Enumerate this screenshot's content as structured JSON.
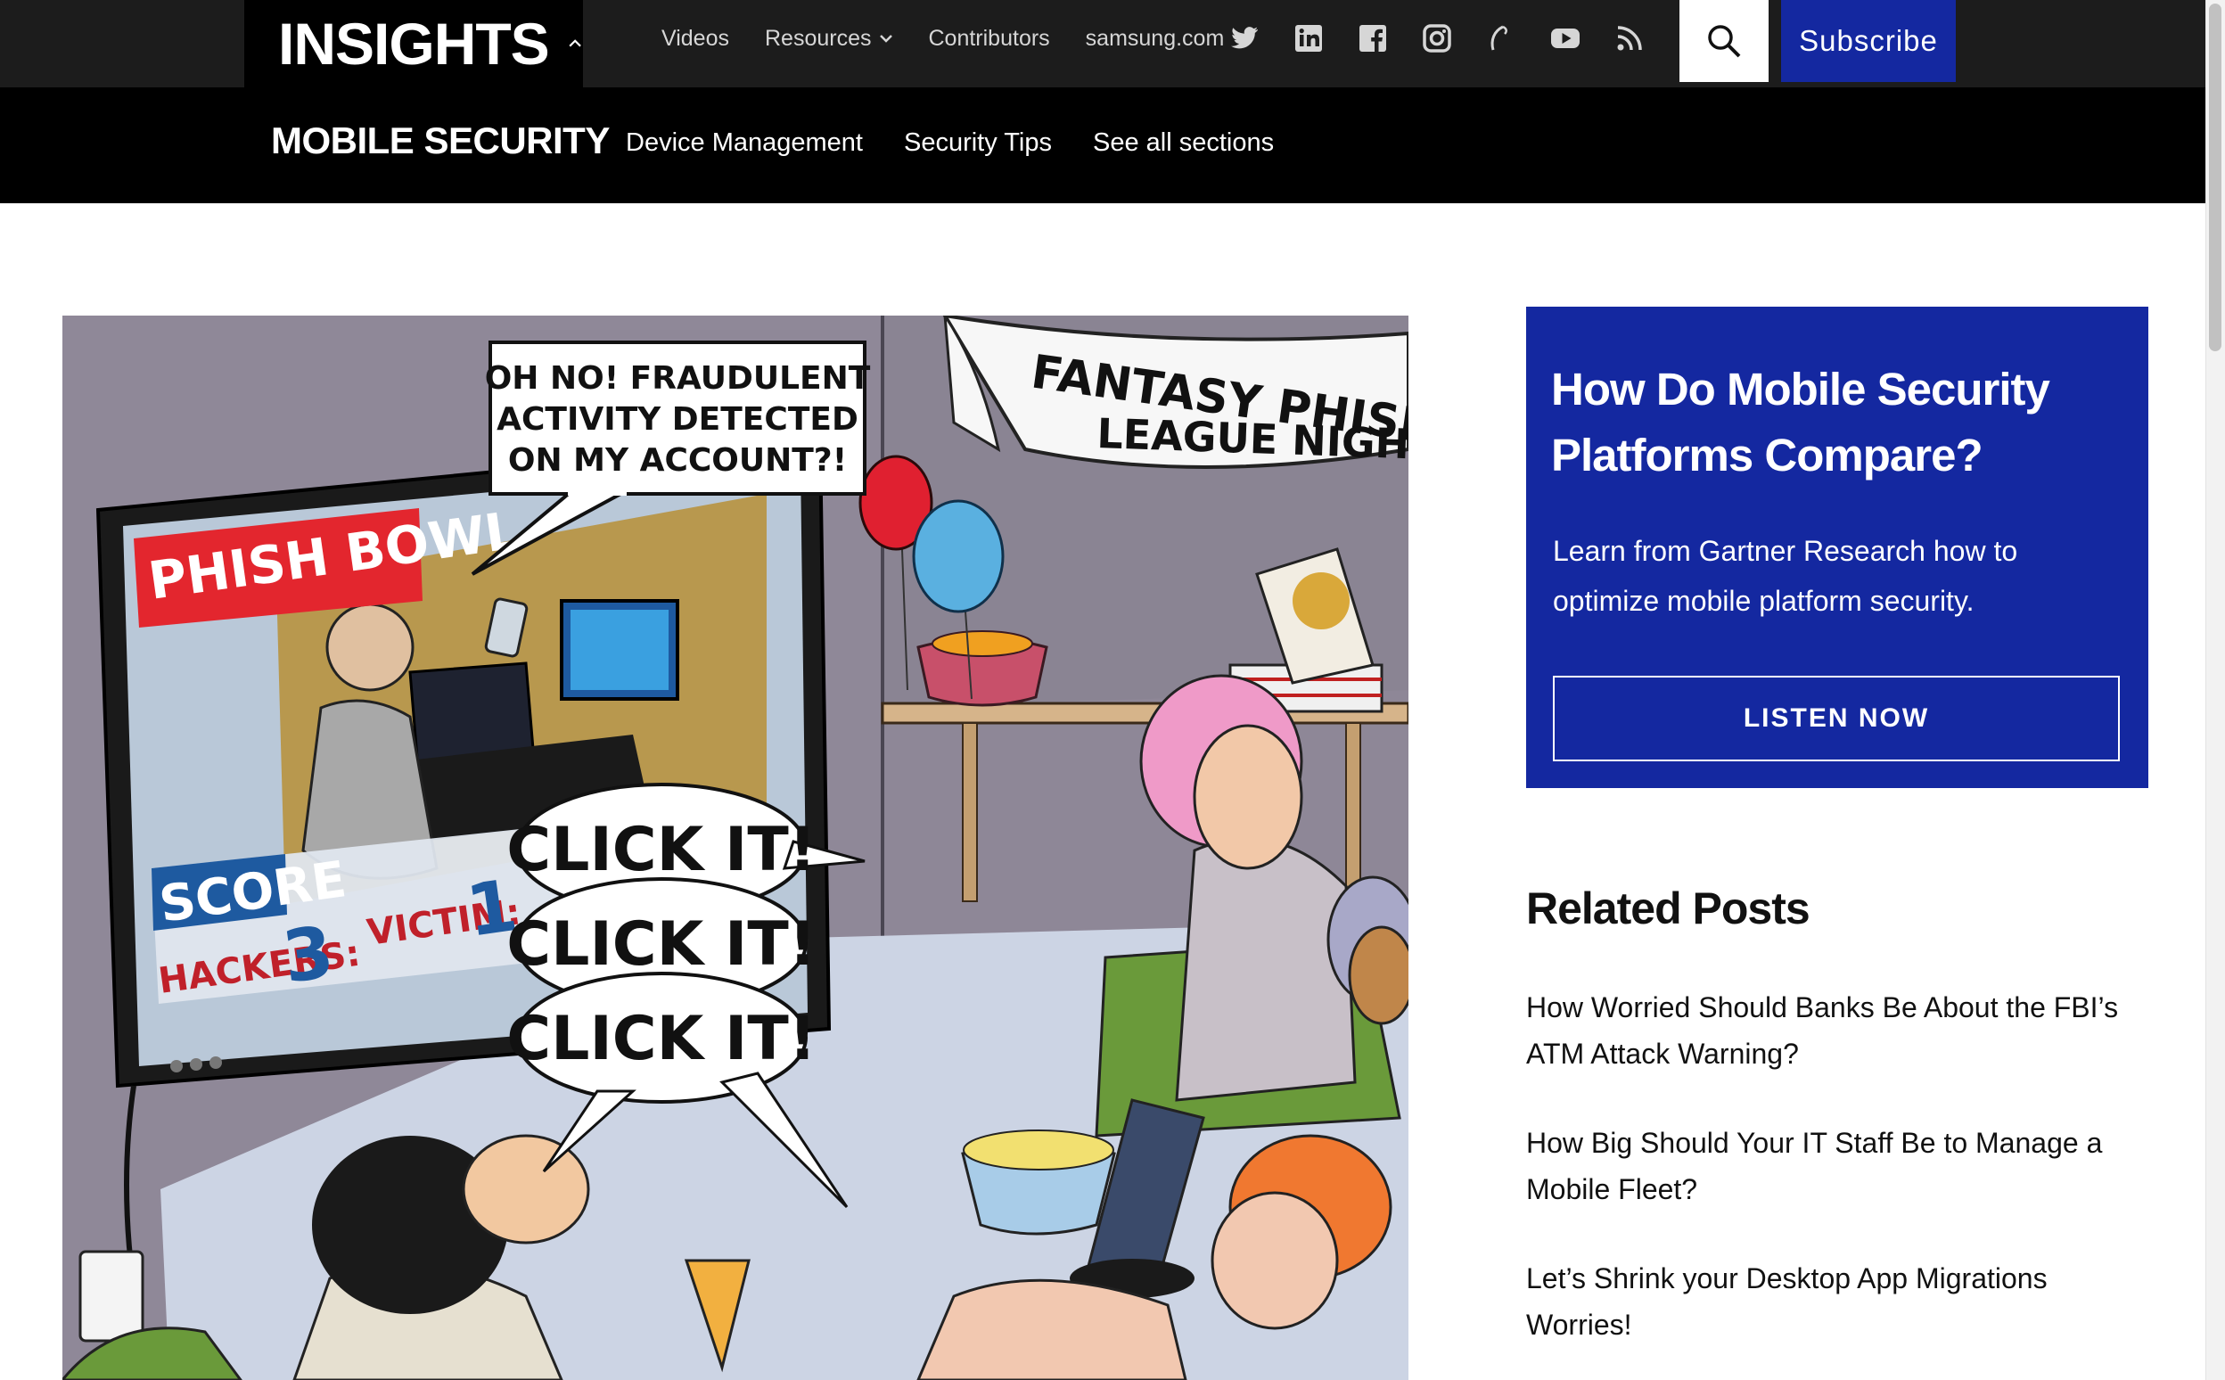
{
  "header": {
    "brand": "INSIGHTS",
    "nav": [
      {
        "label": "Videos"
      },
      {
        "label": "Resources",
        "has_dropdown": true
      },
      {
        "label": "Contributors"
      },
      {
        "label": "samsung.com"
      }
    ],
    "social_icons": [
      "twitter-icon",
      "linkedin-icon",
      "facebook-icon",
      "instagram-icon",
      "flipboard-icon",
      "youtube-icon",
      "rss-icon"
    ],
    "subscribe_label": "Subscribe",
    "brand_color": "#1428a0"
  },
  "section_bar": {
    "title": "MOBILE SECURITY",
    "links": [
      "Device Management",
      "Security Tips",
      "See all sections"
    ]
  },
  "hero": {
    "speech_bubble": [
      "OH NO! FRAUDULENT",
      "ACTIVITY DETECTED",
      "ON MY ACCOUNT?!"
    ],
    "banner": [
      "FANTASY PHISHING",
      "LEAGUE NIGHT"
    ],
    "tv_title": "PHISH BOWL",
    "score_label": "SCORE",
    "hackers_label": "HACKERS:",
    "hackers_score": "3",
    "victim_label": "VICTIM:",
    "victim_score": "1",
    "chant": [
      "CLICK IT!",
      "CLICK IT!",
      "CLICK IT!"
    ]
  },
  "promo": {
    "title": "How Do Mobile Security Platforms Compare?",
    "description": "Learn from Gartner Research how to optimize mobile platform security.",
    "button_label": "LISTEN NOW"
  },
  "related": {
    "title": "Related Posts",
    "posts": [
      "How Worried Should Banks Be About the FBI’s ATM Attack Warning?",
      "How Big Should Your IT Staff Be to Manage a Mobile Fleet?",
      "Let’s Shrink your Desktop App Migrations Worries!"
    ]
  }
}
